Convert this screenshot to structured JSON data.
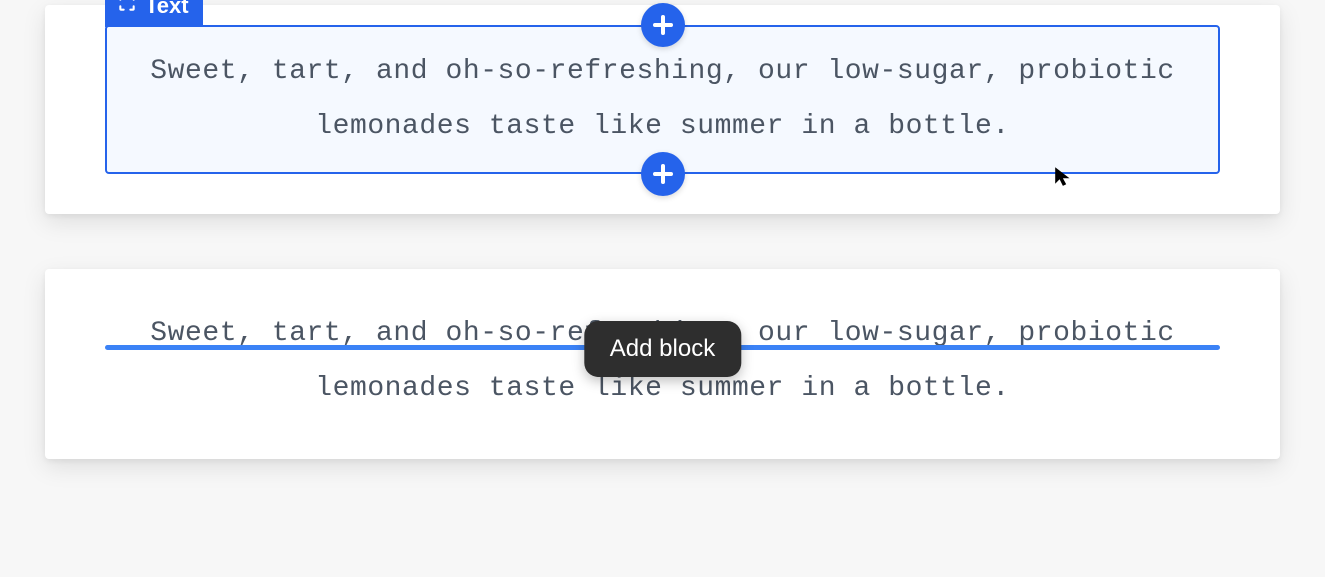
{
  "card1": {
    "label": "Text",
    "content": "Sweet, tart, and oh-so-refreshing, our low-sugar, probiotic lemonades taste like summer in a bottle."
  },
  "card2": {
    "tooltip": "Add block",
    "content": "Sweet, tart, and oh-so-refreshing, our low-sugar, probiotic lemonades taste like summer in a bottle."
  }
}
